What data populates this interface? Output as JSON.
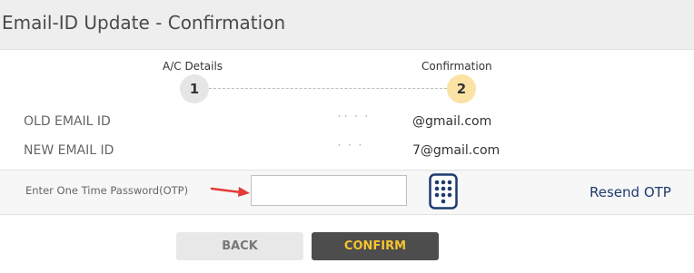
{
  "header": {
    "title": "Email-ID Update - Confirmation"
  },
  "steps": [
    {
      "label": "A/C Details",
      "number": "1",
      "active": false
    },
    {
      "label": "Confirmation",
      "number": "2",
      "active": true
    }
  ],
  "fields": {
    "old_email": {
      "label": "OLD EMAIL ID",
      "value": "@gmail.com"
    },
    "new_email": {
      "label": "NEW EMAIL ID",
      "value": "7@gmail.com"
    }
  },
  "otp": {
    "label": "Enter One Time Password(OTP)",
    "value": "",
    "keypad_icon": "keypad-icon",
    "resend_label": "Resend OTP"
  },
  "actions": {
    "back_label": "BACK",
    "confirm_label": "CONFIRM"
  },
  "colors": {
    "accent": "#f4c430",
    "active_step": "#fbe3a6",
    "link": "#1f3a6e",
    "arrow": "#e53935"
  }
}
